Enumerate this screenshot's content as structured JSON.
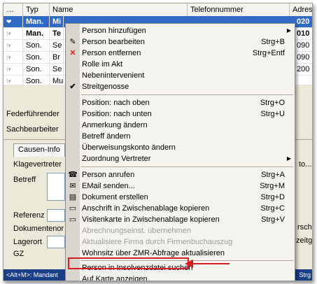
{
  "table": {
    "headers": [
      "…",
      "Typ",
      "Name",
      "Telefonnummer",
      "Adress"
    ],
    "rows": [
      {
        "typ": "Man.",
        "name": "Mi",
        "right": "020"
      },
      {
        "typ": "Man.",
        "name": "Te",
        "right": "010"
      },
      {
        "typ": "Son.",
        "name": "Se",
        "right": "090"
      },
      {
        "typ": "Son.",
        "name": "Br",
        "right": "090"
      },
      {
        "typ": "Son.",
        "name": "Se",
        "right": "200"
      },
      {
        "typ": "Son.",
        "name": "Mu",
        "right": ""
      }
    ]
  },
  "form": {
    "federfuehrender": "Federführender",
    "sachbearbeiter": "Sachbearbeiter",
    "tab_causen": "Causen-Info",
    "klagevertreter": "Klagevertreter",
    "betreff": "Betreff",
    "referenz": "Referenz",
    "dokumentenor": "Dokumentenor",
    "lagerort": "Lagerort",
    "gz": "GZ",
    "right_to": "to...",
    "right_rsch": "rsch",
    "right_zeitge": "zeitge",
    "status_left": "<Alt+M>: Mandant",
    "status_right": "Strg"
  },
  "menu": {
    "items": [
      {
        "label": "Person hinzufügen",
        "shortcut": "",
        "submenu": true,
        "icon": "",
        "disabled": false
      },
      {
        "label": "Person bearbeiten",
        "shortcut": "Strg+B",
        "submenu": false,
        "icon": "edit-icon",
        "disabled": false
      },
      {
        "label": "Person entfernen",
        "shortcut": "Strg+Entf",
        "submenu": false,
        "icon": "delete-icon",
        "disabled": false
      },
      {
        "label": "Rolle im Akt",
        "shortcut": "",
        "submenu": false,
        "icon": "",
        "disabled": false
      },
      {
        "label": "Nebenintervenient",
        "shortcut": "",
        "submenu": false,
        "icon": "",
        "disabled": false
      },
      {
        "label": "Streitgenosse",
        "shortcut": "",
        "submenu": false,
        "icon": "check-icon",
        "disabled": false
      },
      {
        "label": "Position: nach oben",
        "shortcut": "Strg+O",
        "submenu": false,
        "icon": "",
        "disabled": false
      },
      {
        "label": "Position: nach unten",
        "shortcut": "Strg+U",
        "submenu": false,
        "icon": "",
        "disabled": false
      },
      {
        "label": "Anmerkung ändern",
        "shortcut": "",
        "submenu": false,
        "icon": "",
        "disabled": false
      },
      {
        "label": "Betreff ändern",
        "shortcut": "",
        "submenu": false,
        "icon": "",
        "disabled": false
      },
      {
        "label": "Überweisungskonto ändern",
        "shortcut": "",
        "submenu": false,
        "icon": "",
        "disabled": false
      },
      {
        "label": "Zuordnung Vertreter",
        "shortcut": "",
        "submenu": true,
        "icon": "",
        "disabled": false
      },
      {
        "label": "Person anrufen",
        "shortcut": "Strg+A",
        "submenu": false,
        "icon": "phone-icon",
        "disabled": false
      },
      {
        "label": "EMail senden...",
        "shortcut": "Strg+M",
        "submenu": false,
        "icon": "mail-icon",
        "disabled": false
      },
      {
        "label": "Dokument erstellen",
        "shortcut": "Strg+D",
        "submenu": false,
        "icon": "document-icon",
        "disabled": false
      },
      {
        "label": "Anschrift in Zwischenablage kopieren",
        "shortcut": "Strg+C",
        "submenu": false,
        "icon": "card-icon",
        "disabled": false
      },
      {
        "label": "Visitenkarte in Zwischenablage kopieren",
        "shortcut": "Strg+V",
        "submenu": false,
        "icon": "card-icon",
        "disabled": false
      },
      {
        "label": "Abrechnungseinst. übernehmen",
        "shortcut": "",
        "submenu": false,
        "icon": "",
        "disabled": true
      },
      {
        "label": "Aktualisiere Firma durch Firmenbuchauszug",
        "shortcut": "",
        "submenu": false,
        "icon": "",
        "disabled": true
      },
      {
        "label": "Wohnsitz über ZMR-Abfrage aktualisieren",
        "shortcut": "",
        "submenu": false,
        "icon": "",
        "disabled": false
      },
      {
        "label": "Person in Insolvenzdatei suchen",
        "shortcut": "",
        "submenu": false,
        "icon": "",
        "disabled": false
      },
      {
        "label": "Auf Karte anzeigen",
        "shortcut": "",
        "submenu": false,
        "icon": "",
        "disabled": false
      }
    ]
  },
  "colors": {
    "selection": "#316ac5",
    "highlight_box": "#d42020",
    "menu_bg": "#f4f3ee"
  }
}
